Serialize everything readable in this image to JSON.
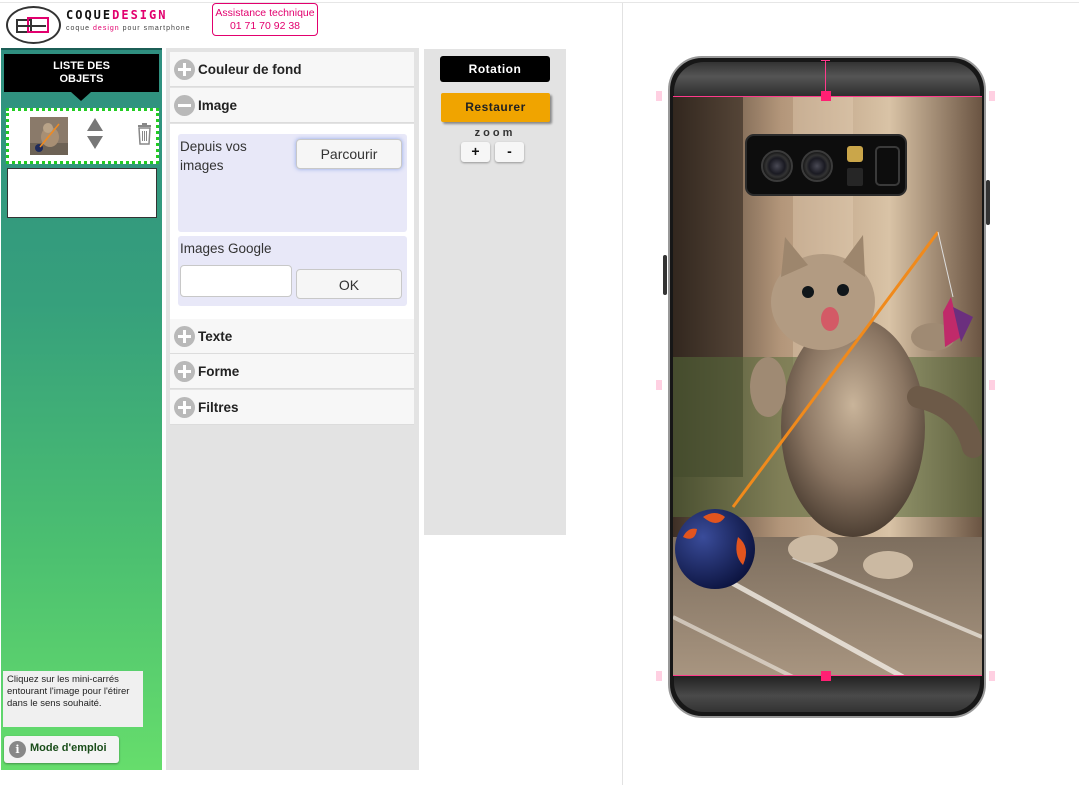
{
  "header": {
    "brand_name_left": "COQUE",
    "brand_name_right": "DESIGN",
    "tagline_start": "coque ",
    "tagline_accent": "design",
    "tagline_end": " pour smartphone",
    "assist_title": "Assistance technique",
    "assist_phone": "01 71 70 92 38"
  },
  "objects_panel": {
    "title_line1": "LISTE DES",
    "title_line2": "OBJETS",
    "hint": "Cliquez sur les mini-carrés entourant l'image pour l'étirer dans le sens souhaité.",
    "mode_label": "Mode d'emploi",
    "info_glyph": "i"
  },
  "editor": {
    "sections": {
      "bg": "Couleur de fond",
      "image": "Image",
      "text": "Texte",
      "shape": "Forme",
      "filters": "Filtres"
    },
    "upload_label_line1": "Depuis vos",
    "upload_label_line2": "images",
    "browse_button": "Parcourir",
    "google_label": "Images Google",
    "google_value": "",
    "ok_button": "OK"
  },
  "tools": {
    "rotation": "Rotation",
    "reset": "Restaurer",
    "zoom_label": "zoom",
    "zoom_in": "+",
    "zoom_out": "-"
  },
  "colors": {
    "accent_pink": "#e2006e",
    "handle_pink": "#ff1f73",
    "reset_orange": "#f0a400",
    "panel_green_top": "#2f8f80",
    "panel_green_bottom": "#66dd6c"
  },
  "icons": [
    "logo-icon",
    "up-down-arrows-icon",
    "trash-icon",
    "plus-circle-icon",
    "minus-circle-icon",
    "info-icon"
  ]
}
